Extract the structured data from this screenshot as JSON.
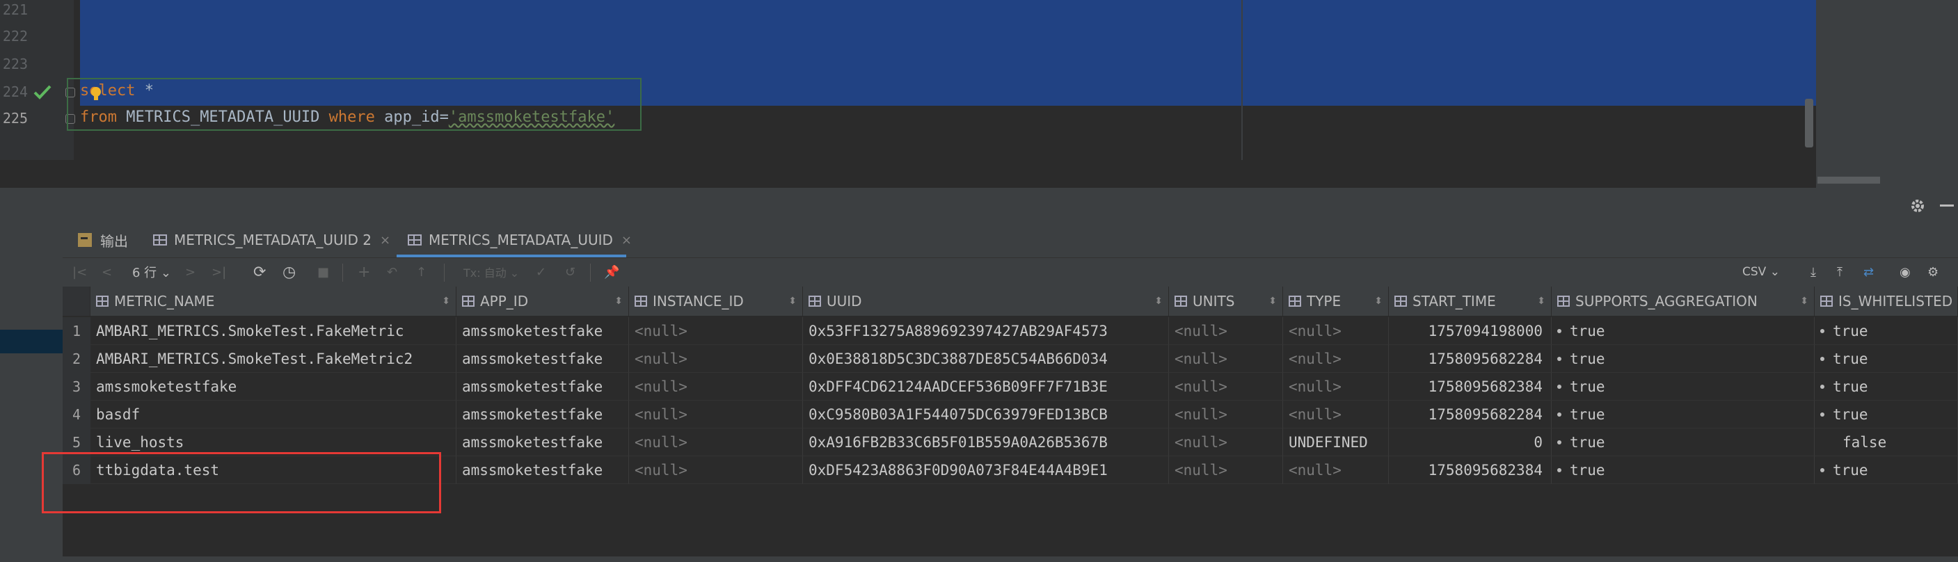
{
  "editor": {
    "line_numbers": [
      "221",
      "222",
      "223",
      "224",
      "225"
    ],
    "line1_keyword": "select",
    "line1_rest": " *",
    "line2_keyword1": "from",
    "line2_table": " METRICS_METADATA_UUID ",
    "line2_keyword2": "where",
    "line2_cond": " app_id=",
    "line2_string": "'amssmoketestfake'"
  },
  "tabs": [
    {
      "label": "输出"
    },
    {
      "label": "METRICS_METADATA_UUID 2",
      "close": "×"
    },
    {
      "label": "METRICS_METADATA_UUID",
      "close": "×"
    }
  ],
  "toolbar": {
    "rows_label": "6 行 ⌄",
    "tx_label": "Tx: 自动 ⌄",
    "export_format": "CSV ⌄"
  },
  "columns": [
    "METRIC_NAME",
    "APP_ID",
    "INSTANCE_ID",
    "UUID",
    "UNITS",
    "TYPE",
    "START_TIME",
    "SUPPORTS_AGGREGATION",
    "IS_WHITELISTED"
  ],
  "rows": [
    {
      "num": "1",
      "metric_name": "AMBARI_METRICS.SmokeTest.FakeMetric",
      "app_id": "amssmoketestfake",
      "instance_id": "<null>",
      "uuid": "0x53FF13275A889692397427AB29AF4573",
      "units": "<null>",
      "type": "<null>",
      "start_time": "1757094198000",
      "supports_aggregation": "true",
      "is_whitelisted": "true"
    },
    {
      "num": "2",
      "metric_name": "AMBARI_METRICS.SmokeTest.FakeMetric2",
      "app_id": "amssmoketestfake",
      "instance_id": "<null>",
      "uuid": "0x0E38818D5C3DC3887DE85C54AB66D034",
      "units": "<null>",
      "type": "<null>",
      "start_time": "1758095682284",
      "supports_aggregation": "true",
      "is_whitelisted": "true"
    },
    {
      "num": "3",
      "metric_name": "amssmoketestfake",
      "app_id": "amssmoketestfake",
      "instance_id": "<null>",
      "uuid": "0xDFF4CD62124AADCEF536B09FF7F71B3E",
      "units": "<null>",
      "type": "<null>",
      "start_time": "1758095682384",
      "supports_aggregation": "true",
      "is_whitelisted": "true"
    },
    {
      "num": "4",
      "metric_name": "basdf",
      "app_id": "amssmoketestfake",
      "instance_id": "<null>",
      "uuid": "0xC9580B03A1F544075DC63979FED13BCB",
      "units": "<null>",
      "type": "<null>",
      "start_time": "1758095682284",
      "supports_aggregation": "true",
      "is_whitelisted": "true"
    },
    {
      "num": "5",
      "metric_name": "live_hosts",
      "app_id": "amssmoketestfake",
      "instance_id": "<null>",
      "uuid": "0xA916FB2B33C6B5F01B559A0A26B5367B",
      "units": "<null>",
      "type": "UNDEFINED",
      "start_time": "0",
      "supports_aggregation": "true",
      "is_whitelisted": "false"
    },
    {
      "num": "6",
      "metric_name": "ttbigdata.test",
      "app_id": "amssmoketestfake",
      "instance_id": "<null>",
      "uuid": "0xDF5423A8863F0D90A073F84E44A4B9E1",
      "units": "<null>",
      "type": "<null>",
      "start_time": "1758095682384",
      "supports_aggregation": "true",
      "is_whitelisted": "true"
    }
  ]
}
